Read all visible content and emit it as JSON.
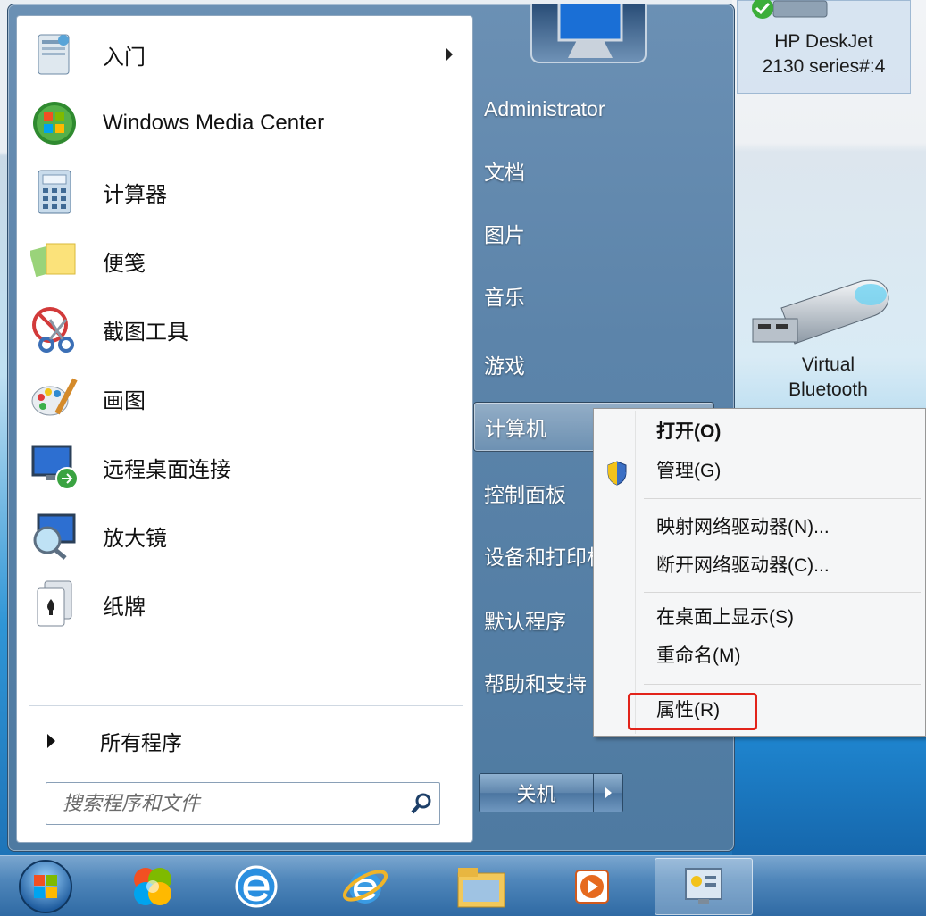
{
  "desktop": {
    "icons": [
      {
        "label_line1": "HP DeskJet",
        "label_line2": "2130 series#:4"
      },
      {
        "label_line1": "Virtual",
        "label_line2": "Bluetooth"
      }
    ]
  },
  "start_menu": {
    "programs": [
      {
        "label": "入门",
        "icon": "getting-started-icon",
        "has_submenu": true
      },
      {
        "label": "Windows Media Center",
        "icon": "windows-media-center-icon"
      },
      {
        "label": "计算器",
        "icon": "calculator-icon"
      },
      {
        "label": "便笺",
        "icon": "sticky-notes-icon"
      },
      {
        "label": "截图工具",
        "icon": "snipping-tool-icon"
      },
      {
        "label": "画图",
        "icon": "paint-icon"
      },
      {
        "label": "远程桌面连接",
        "icon": "remote-desktop-icon"
      },
      {
        "label": "放大镜",
        "icon": "magnifier-icon"
      },
      {
        "label": "纸牌",
        "icon": "solitaire-icon"
      }
    ],
    "all_programs": "所有程序",
    "search_placeholder": "搜索程序和文件",
    "right_pane": [
      "Administrator",
      "文档",
      "图片",
      "音乐",
      "游戏",
      "计算机",
      "控制面板",
      "设备和打印机",
      "默认程序",
      "帮助和支持"
    ],
    "shutdown_label": "关机"
  },
  "context_menu": {
    "items": [
      "打开(O)",
      "管理(G)",
      "映射网络驱动器(N)...",
      "断开网络驱动器(C)...",
      "在桌面上显示(S)",
      "重命名(M)",
      "属性(R)"
    ],
    "highlighted": "属性(R)",
    "highlight_color": "#e2231a"
  },
  "taskbar": {
    "icons": [
      "start-orb-icon",
      "color-pinwheel-icon",
      "browser-e-icon",
      "internet-explorer-icon",
      "file-explorer-icon",
      "media-player-icon",
      "control-panel-icon"
    ]
  }
}
